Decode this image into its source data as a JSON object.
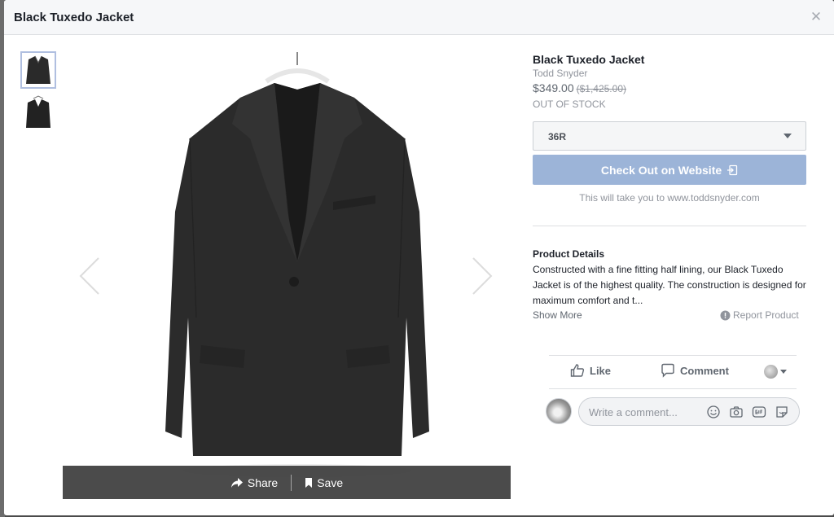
{
  "modal": {
    "title": "Black Tuxedo Jacket",
    "close_icon": "close-icon"
  },
  "product": {
    "title": "Black Tuxedo Jacket",
    "brand": "Todd Snyder",
    "price": "$349.00",
    "original_price": "($1,425.00)",
    "stock_status": "OUT OF STOCK",
    "size_selected": "36R",
    "checkout_label": "Check Out on Website",
    "redirect_note": "This will take you to www.toddsnyder.com",
    "details_heading": "Product Details",
    "details_text": "Constructed with a fine fitting half lining, our Black Tuxedo Jacket is of the highest quality. The construction is designed for maximum comfort and t...",
    "show_more": "Show More",
    "report": "Report Product"
  },
  "image_actions": {
    "share": "Share",
    "save": "Save"
  },
  "social": {
    "like": "Like",
    "comment": "Comment",
    "comment_placeholder": "Write a comment..."
  },
  "colors": {
    "checkout_bg": "#9cb4d8",
    "header_bg": "#f6f7f9",
    "action_bar_bg": "#3c3c3c"
  }
}
